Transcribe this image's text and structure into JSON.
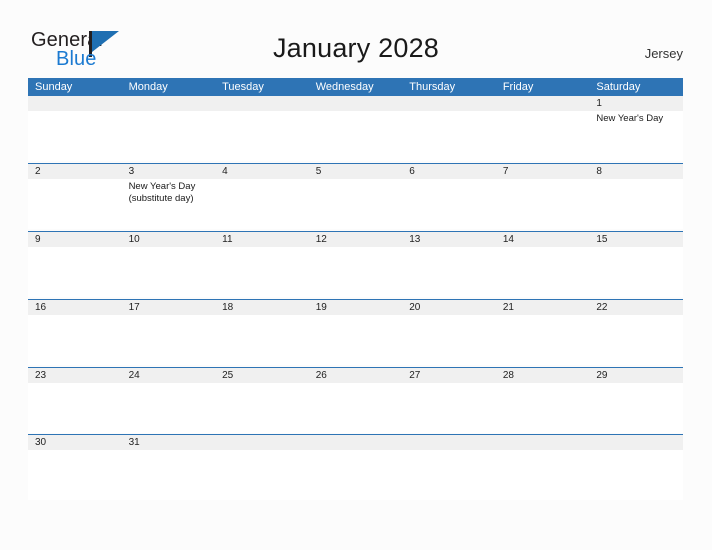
{
  "brand": {
    "name_part1": "General",
    "name_part2": "Blue",
    "flag_icon": "flag-triangle-icon",
    "accent_color": "#1b7ad1"
  },
  "header": {
    "title": "January 2028",
    "location": "Jersey"
  },
  "theme": {
    "header_blue": "#2e74b5",
    "row_divider_blue": "#2e74b5",
    "date_band_gray": "#f0f0f0",
    "page_background": "#fcfcfc"
  },
  "calendar": {
    "weekdays": [
      "Sunday",
      "Monday",
      "Tuesday",
      "Wednesday",
      "Thursday",
      "Friday",
      "Saturday"
    ],
    "weeks": [
      {
        "days": [
          {
            "num": "",
            "events": []
          },
          {
            "num": "",
            "events": []
          },
          {
            "num": "",
            "events": []
          },
          {
            "num": "",
            "events": []
          },
          {
            "num": "",
            "events": []
          },
          {
            "num": "",
            "events": []
          },
          {
            "num": "1",
            "events": [
              "New Year's Day"
            ]
          }
        ]
      },
      {
        "days": [
          {
            "num": "2",
            "events": []
          },
          {
            "num": "3",
            "events": [
              "New Year's Day",
              "(substitute day)"
            ]
          },
          {
            "num": "4",
            "events": []
          },
          {
            "num": "5",
            "events": []
          },
          {
            "num": "6",
            "events": []
          },
          {
            "num": "7",
            "events": []
          },
          {
            "num": "8",
            "events": []
          }
        ]
      },
      {
        "days": [
          {
            "num": "9",
            "events": []
          },
          {
            "num": "10",
            "events": []
          },
          {
            "num": "11",
            "events": []
          },
          {
            "num": "12",
            "events": []
          },
          {
            "num": "13",
            "events": []
          },
          {
            "num": "14",
            "events": []
          },
          {
            "num": "15",
            "events": []
          }
        ]
      },
      {
        "days": [
          {
            "num": "16",
            "events": []
          },
          {
            "num": "17",
            "events": []
          },
          {
            "num": "18",
            "events": []
          },
          {
            "num": "19",
            "events": []
          },
          {
            "num": "20",
            "events": []
          },
          {
            "num": "21",
            "events": []
          },
          {
            "num": "22",
            "events": []
          }
        ]
      },
      {
        "days": [
          {
            "num": "23",
            "events": []
          },
          {
            "num": "24",
            "events": []
          },
          {
            "num": "25",
            "events": []
          },
          {
            "num": "26",
            "events": []
          },
          {
            "num": "27",
            "events": []
          },
          {
            "num": "28",
            "events": []
          },
          {
            "num": "29",
            "events": []
          }
        ]
      },
      {
        "days": [
          {
            "num": "30",
            "events": []
          },
          {
            "num": "31",
            "events": []
          },
          {
            "num": "",
            "events": []
          },
          {
            "num": "",
            "events": []
          },
          {
            "num": "",
            "events": []
          },
          {
            "num": "",
            "events": []
          },
          {
            "num": "",
            "events": []
          }
        ]
      }
    ]
  }
}
